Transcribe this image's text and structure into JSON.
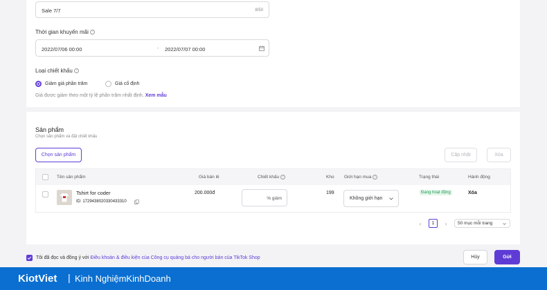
{
  "promo": {
    "name_value": "Sale 7/7",
    "name_counter": "8/50",
    "time_label": "Thời gian khuyến mãi",
    "start": "2022/07/06 00:00",
    "separator": "-",
    "end": "2022/07/07 00:00",
    "discount_type_label": "Loại chiết khấu",
    "option_percent": "Giảm giá phần trăm",
    "option_fixed": "Giá cố định",
    "hint_text": "Giá được giảm theo một tỷ lệ phần trăm nhất định.",
    "hint_link": "Xem mẫu"
  },
  "products": {
    "title": "Sản phẩm",
    "subtitle": "Chọn sản phẩm và đặt chiết khấu",
    "select_button": "Chọn sản phẩm",
    "update_button": "Cập nhật",
    "delete_button": "Xóa",
    "columns": [
      "Tên sản phẩm",
      "Giá bán lẻ",
      "Chiết khấu",
      "Kho",
      "Giới hạn mua",
      "Trạng thái",
      "Hành động"
    ],
    "rows": [
      {
        "name": "Tshirt for coder",
        "id": "ID: 1729438020330433310",
        "price": "200.000đ",
        "discount_placeholder": "% giảm",
        "stock": "199",
        "limit": "Không giới hạn",
        "status": "Đang hoạt động",
        "action": "Xóa"
      }
    ],
    "pagination": {
      "prev": "‹",
      "current": "1",
      "next": "›",
      "page_size": "50 mục mỗi trang"
    }
  },
  "footer": {
    "agree_prefix": "Tôi đã đọc và đồng ý với",
    "agree_link": "Điều khoản & điều kiện của Công cụ quảng bá cho người bán của TikTok Shop",
    "cancel_button": "Hủy",
    "submit_button": "Gửi"
  },
  "brand": {
    "name": "KiotViet",
    "divider": "|",
    "tagline": "Kinh NghiệmKinhDoanh"
  },
  "colors": {
    "accent": "#5f3bd6",
    "brand_bar": "#0a6fd1",
    "status_green": "#1e9e55"
  }
}
